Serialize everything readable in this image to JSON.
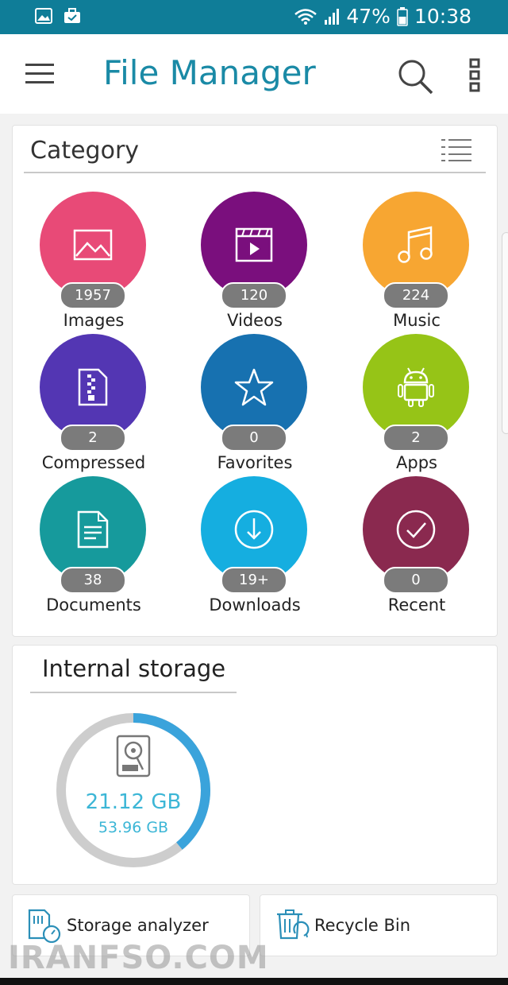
{
  "status": {
    "battery": "47%",
    "time": "10:38",
    "icons": [
      "image-icon",
      "briefcase-icon",
      "wifi-icon",
      "signal-icon",
      "battery-icon"
    ]
  },
  "app": {
    "title": "File Manager",
    "accent": "#1a8aa6",
    "bar_color": "#0f7d98"
  },
  "category": {
    "title": "Category",
    "items": [
      {
        "label": "Images",
        "count": "1957",
        "color": "#e84a77",
        "icon": "image-icon"
      },
      {
        "label": "Videos",
        "count": "120",
        "color": "#7a0f7d",
        "icon": "video-icon"
      },
      {
        "label": "Music",
        "count": "224",
        "color": "#f7a632",
        "icon": "music-icon"
      },
      {
        "label": "Compressed",
        "count": "2",
        "color": "#5336b3",
        "icon": "zip-icon"
      },
      {
        "label": "Favorites",
        "count": "0",
        "color": "#1771b0",
        "icon": "star-icon"
      },
      {
        "label": "Apps",
        "count": "2",
        "color": "#96c417",
        "icon": "android-icon"
      },
      {
        "label": "Documents",
        "count": "38",
        "color": "#169a9c",
        "icon": "document-icon"
      },
      {
        "label": "Downloads",
        "count": "19+",
        "color": "#15aee0",
        "icon": "download-icon"
      },
      {
        "label": "Recent",
        "count": "0",
        "color": "#8a294f",
        "icon": "check-circle-icon"
      }
    ]
  },
  "storage": {
    "title": "Internal storage",
    "used": "21.12 GB",
    "total": "53.96 GB",
    "used_fraction": 0.39
  },
  "tools": [
    {
      "label": "Storage analyzer",
      "icon": "storage-analyzer-icon"
    },
    {
      "label": "Recycle Bin",
      "icon": "recycle-bin-icon"
    }
  ],
  "watermark": "IRANFSO.COM"
}
